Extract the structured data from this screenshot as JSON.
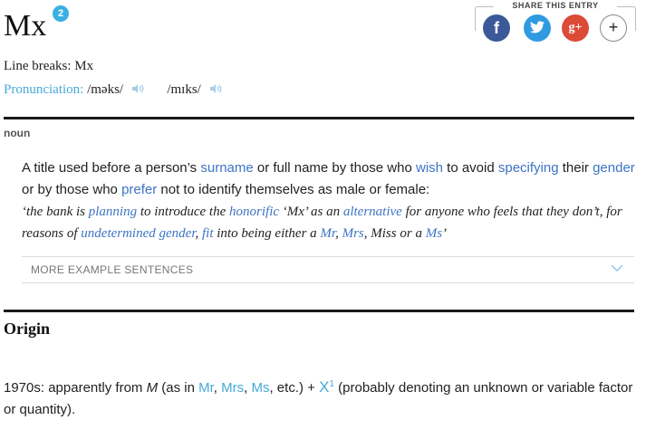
{
  "entry": {
    "headword": "Mx",
    "homograph": "2",
    "line_breaks_label": "Line breaks: Mx",
    "pronunciation_label": "Pronunciation:",
    "pronunciations": [
      "/məks/",
      "/mɪks/"
    ]
  },
  "share": {
    "title": "SHARE THIS ENTRY",
    "facebook": "f",
    "twitter": "t",
    "google": "g+",
    "more": "+"
  },
  "sense": {
    "part_of_speech": "noun",
    "definition": [
      {
        "t": "A title used before a person’s ",
        "link": false
      },
      {
        "t": "surname",
        "link": true
      },
      {
        "t": " or full name by those who ",
        "link": false
      },
      {
        "t": "wish",
        "link": true
      },
      {
        "t": " to avoid ",
        "link": false
      },
      {
        "t": "specifying",
        "link": true
      },
      {
        "t": " their ",
        "link": false
      },
      {
        "t": "gender",
        "link": true
      },
      {
        "t": " or by those who ",
        "link": false
      },
      {
        "t": "prefer",
        "link": true
      },
      {
        "t": " not to identify themselves as male or female:",
        "link": false
      }
    ],
    "example": [
      {
        "t": "‘the bank is ",
        "link": false
      },
      {
        "t": "planning",
        "link": true
      },
      {
        "t": " to introduce the ",
        "link": false
      },
      {
        "t": "honorific",
        "link": true
      },
      {
        "t": " ‘Mx’ as an ",
        "link": false
      },
      {
        "t": "alternative",
        "link": true
      },
      {
        "t": " for anyone who feels that they don’t, for reasons of ",
        "link": false
      },
      {
        "t": "undetermined gender",
        "link": true
      },
      {
        "t": ", ",
        "link": false
      },
      {
        "t": "fit",
        "link": true
      },
      {
        "t": " into being either a ",
        "link": false
      },
      {
        "t": "Mr",
        "link": true
      },
      {
        "t": ", ",
        "link": false
      },
      {
        "t": "Mrs",
        "link": true
      },
      {
        "t": ", Miss or a ",
        "link": false
      },
      {
        "t": "Ms",
        "link": true
      },
      {
        "t": "’",
        "link": false
      }
    ],
    "more_examples_label": "MORE EXAMPLE SENTENCES"
  },
  "origin": {
    "heading": "Origin",
    "body": [
      {
        "t": "1970s: apparently from ",
        "link": false
      },
      {
        "t": "M",
        "italic": true
      },
      {
        "t": " (as in ",
        "link": false
      },
      {
        "t": "Mr",
        "link": true
      },
      {
        "t": ", ",
        "link": false
      },
      {
        "t": "Mrs",
        "link": true
      },
      {
        "t": ", ",
        "link": false
      },
      {
        "t": "Ms",
        "link": true
      },
      {
        "t": ", etc.) + ",
        "link": false
      },
      {
        "t": "X",
        "link": true,
        "big": true
      },
      {
        "t": "1",
        "sup": true
      },
      {
        "t": " (probably denoting an unknown or variable factor or quantity).",
        "link": false
      }
    ]
  },
  "colors": {
    "link": "#3d74c4",
    "link_light": "#46a9d9",
    "facebook": "#3b5998",
    "twitter": "#2f9ae0",
    "google": "#dc4a38"
  }
}
